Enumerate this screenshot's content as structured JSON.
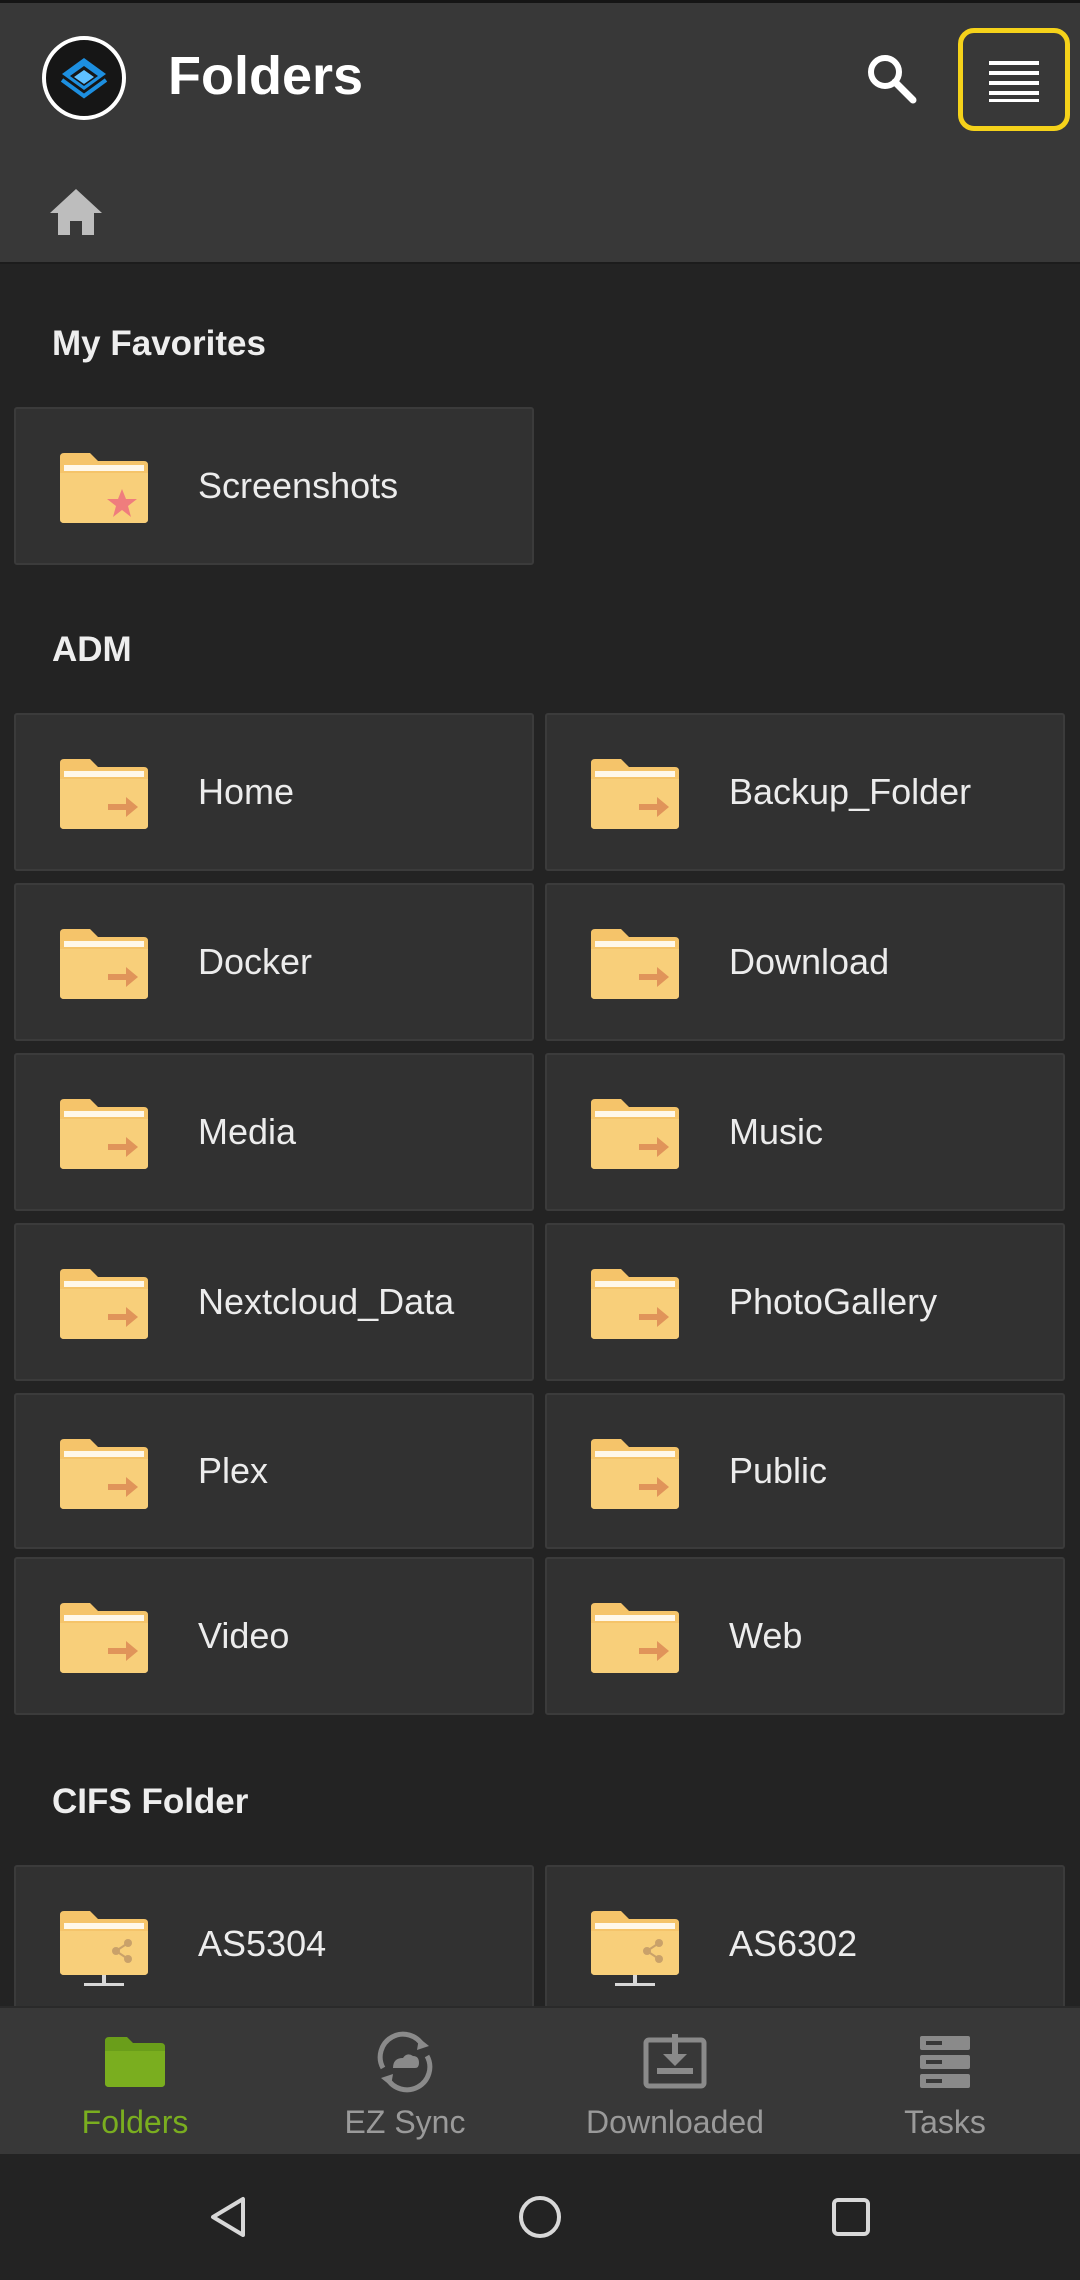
{
  "header": {
    "title": "Folders",
    "logo_icon": "app-logo-icon",
    "search_icon": "search-icon",
    "menu_icon": "menu-list-icon",
    "highlight_color": "#f5d21a"
  },
  "breadcrumb": {
    "home_icon": "home-icon"
  },
  "sections": {
    "favorites": {
      "title": "My Favorites",
      "items": [
        {
          "label": "Screenshots",
          "icon": "favorite-folder-icon"
        }
      ]
    },
    "adm": {
      "title": "ADM",
      "items": [
        {
          "label": "Home",
          "icon": "shared-folder-icon"
        },
        {
          "label": "Backup_Folder",
          "icon": "shared-folder-icon"
        },
        {
          "label": "Docker",
          "icon": "shared-folder-icon"
        },
        {
          "label": "Download",
          "icon": "shared-folder-icon"
        },
        {
          "label": "Media",
          "icon": "shared-folder-icon"
        },
        {
          "label": "Music",
          "icon": "shared-folder-icon"
        },
        {
          "label": "Nextcloud_Data",
          "icon": "shared-folder-icon"
        },
        {
          "label": "PhotoGallery",
          "icon": "shared-folder-icon"
        },
        {
          "label": "Plex",
          "icon": "shared-folder-icon"
        },
        {
          "label": "Public",
          "icon": "shared-folder-icon"
        },
        {
          "label": "Video",
          "icon": "shared-folder-icon"
        },
        {
          "label": "Web",
          "icon": "shared-folder-icon"
        }
      ]
    },
    "cifs": {
      "title": "CIFS Folder",
      "items": [
        {
          "label": "AS5304",
          "icon": "network-folder-icon"
        },
        {
          "label": "AS6302",
          "icon": "network-folder-icon"
        }
      ]
    }
  },
  "bottom_nav": {
    "active_color": "#7aae1f",
    "items": [
      {
        "label": "Folders",
        "icon": "folder-icon",
        "active": true
      },
      {
        "label": "EZ Sync",
        "icon": "ez-sync-icon",
        "active": false
      },
      {
        "label": "Downloaded",
        "icon": "download-tray-icon",
        "active": false
      },
      {
        "label": "Tasks",
        "icon": "tasks-icon",
        "active": false
      }
    ]
  },
  "system_nav": {
    "back_icon": "back-icon",
    "home_icon": "home-circle-icon",
    "recents_icon": "recents-icon"
  }
}
